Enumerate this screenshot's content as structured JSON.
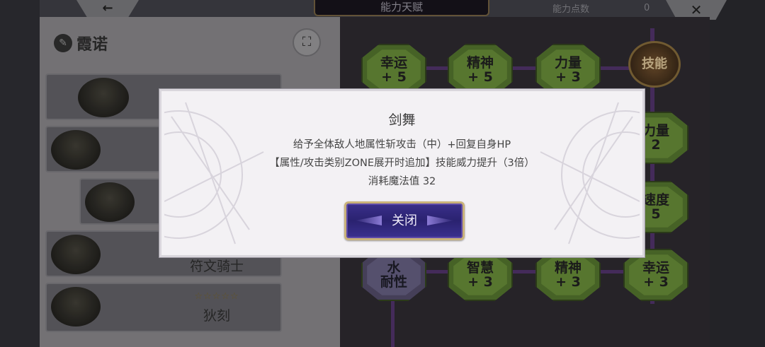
{
  "header": {
    "back_icon": "←",
    "tab_title": "能力天赋",
    "points_label": "能力点数",
    "points_value": "0",
    "close_icon": "✕"
  },
  "character": {
    "tag_icon": "✎",
    "name": "霞诺",
    "node_icon": "⛶"
  },
  "units": [
    {
      "label": ""
    },
    {
      "label": ""
    },
    {
      "label": ""
    },
    {
      "label": "符文骑士"
    },
    {
      "label": "狄刻",
      "stars": "☆☆☆☆☆"
    }
  ],
  "tree": {
    "nodes": [
      {
        "name": "幸运",
        "value": "+ 5"
      },
      {
        "name": "精神",
        "value": "+ 5"
      },
      {
        "name": "力量",
        "value": "+ 3"
      },
      {
        "name": "力量",
        "value": "2"
      },
      {
        "name": "速度",
        "value": "5"
      },
      {
        "name": "水",
        "value": "耐性"
      },
      {
        "name": "智慧",
        "value": "+ 3"
      },
      {
        "name": "精神",
        "value": "+ 3"
      },
      {
        "name": "幸运",
        "value": "+ 3"
      }
    ],
    "skill_label": "技能"
  },
  "dialog": {
    "title": "剑舞",
    "lines": [
      "给予全体敌人地属性斩攻击（中）+回复自身HP",
      "【属性/攻击类别ZONE展开时追加】技能威力提升（3倍）",
      "消耗魔法值 32"
    ],
    "close_label": "关闭"
  },
  "colors": {
    "dialog_bg": "#f3f1f4",
    "button_bg": "#2a2270",
    "button_border": "#c9b27a",
    "node_green": "#5f8033",
    "line_purple": "#4a2f62"
  }
}
